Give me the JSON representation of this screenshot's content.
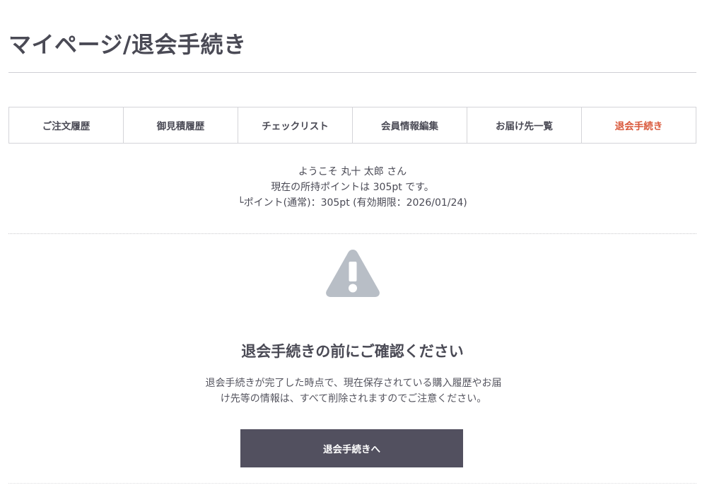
{
  "header": {
    "title": "マイページ/退会手続き"
  },
  "tabs": [
    {
      "label": "ご注文履歴",
      "active": false
    },
    {
      "label": "御見積履歴",
      "active": false
    },
    {
      "label": "チェックリスト",
      "active": false
    },
    {
      "label": "会員情報編集",
      "active": false
    },
    {
      "label": "お届け先一覧",
      "active": false
    },
    {
      "label": "退会手続き",
      "active": true
    }
  ],
  "welcome": {
    "greeting": "ようこそ 丸十 太郎 さん",
    "points_line": "現在の所持ポイントは 305pt です。",
    "points_detail": "└ポイント(通常)：305pt (有効期限：2026/01/24)"
  },
  "warning": {
    "icon": "warning-triangle-icon",
    "icon_color": "#b8bec6",
    "heading": "退会手続きの前にご確認ください",
    "notice_line1": "退会手続きが完了した時点で、現在保存されている購入履歴やお届",
    "notice_line2": "け先等の情報は、すべて削除されますのでご注意ください。"
  },
  "actions": {
    "proceed_label": "退会手続きへ"
  },
  "colors": {
    "text": "#4a4a55",
    "active_tab": "#d9583b",
    "button_bg": "#52505f",
    "button_text": "#ffffff"
  }
}
